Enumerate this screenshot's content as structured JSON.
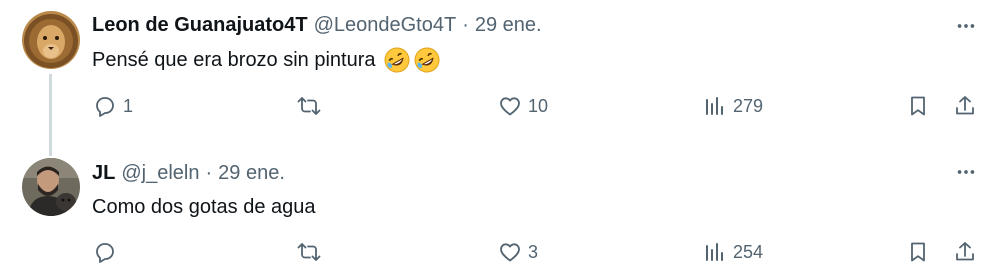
{
  "tweets": [
    {
      "author_name": "Leon de Guanajuato4T",
      "handle": "@LeondeGto4T",
      "separator": "·",
      "date": "29 ene.",
      "text": "Pensé que era brozo sin pintura",
      "emojis": [
        "rolling-on-floor-laughing",
        "rolling-on-floor-laughing"
      ],
      "replies": "1",
      "reposts": "",
      "likes": "10",
      "views": "279"
    },
    {
      "author_name": "JL",
      "handle": "@j_eleln",
      "separator": "·",
      "date": "29 ene.",
      "text": "Como dos gotas de agua",
      "replies": "",
      "reposts": "",
      "likes": "3",
      "views": "254"
    }
  ],
  "icons": {
    "reply": "reply-icon",
    "repost": "repost-icon",
    "like": "heart-icon",
    "views": "views-icon",
    "bookmark": "bookmark-icon",
    "share": "share-icon",
    "more": "more-icon"
  },
  "colors": {
    "text_primary": "#0f1419",
    "text_secondary": "#536471",
    "thread_line": "#cfd9de",
    "emoji_face": "#ffc83d"
  }
}
